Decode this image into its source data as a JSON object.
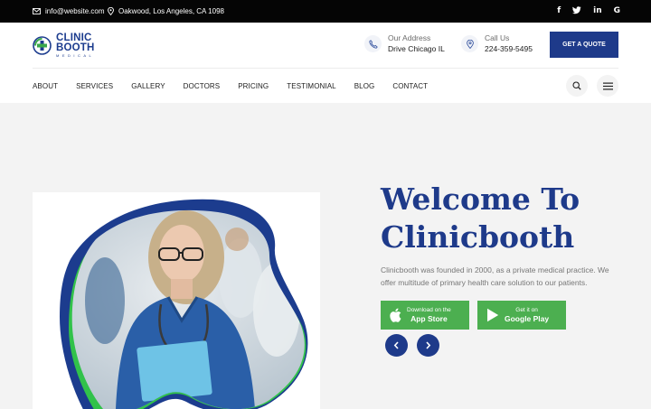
{
  "topbar": {
    "email": "info@website.com",
    "address": "Oakwood, Los Angeles, CA 1098",
    "social": [
      {
        "icon": "facebook-icon",
        "glyph": "f"
      },
      {
        "icon": "twitter-icon",
        "glyph": "🐦"
      },
      {
        "icon": "linkedin-icon",
        "glyph": "in"
      },
      {
        "icon": "google-icon",
        "glyph": "G"
      }
    ]
  },
  "logo": {
    "line1": "CLINIC",
    "line2": "BOOTH",
    "line3": "MEDICAL"
  },
  "contact": {
    "address_label": "Our Address",
    "address_value": "Drive Chicago IL",
    "call_label": "Call Us",
    "call_value": "224-359-5495"
  },
  "quote_button": "GET A QUOTE",
  "nav": {
    "items": [
      "ABOUT",
      "SERVICES",
      "GALLERY",
      "DOCTORS",
      "PRICING",
      "TESTIMONIAL",
      "BLOG",
      "CONTACT"
    ]
  },
  "hero": {
    "title_line1": "Welcome To",
    "title_line2": "Clinicbooth",
    "description": "Clinicbooth was founded in 2000, as a private medical practice. We offer multitude of primary health care solution to our patients.",
    "app_store": {
      "small": "Download on the",
      "big": "App Store"
    },
    "google_play": {
      "small": "Get it on",
      "big": "Google Play"
    }
  },
  "colors": {
    "brand": "#1e3a8a",
    "accent": "#4caf50",
    "topbar": "#050505"
  }
}
